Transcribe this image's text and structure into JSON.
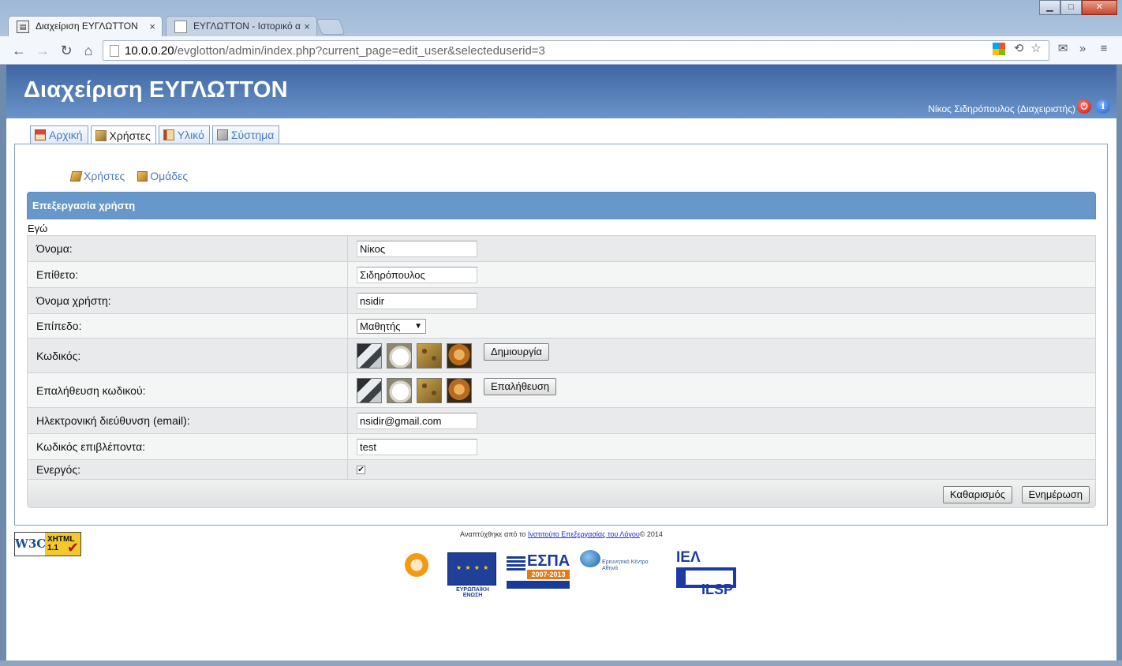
{
  "browser": {
    "tabs": [
      {
        "title": "Διαχείριση ΕΥΓΛΩΤΤΟΝ",
        "active": true
      },
      {
        "title": "ΕΥΓΛΩΤΤΟΝ - Ιστορικό α",
        "active": false
      }
    ],
    "close_glyph": "×",
    "window_controls": {
      "minimize": "▁",
      "maximize": "□",
      "close": "✕"
    },
    "url": {
      "host": "10.0.0.20",
      "path": "/evglotton/admin/index.php?current_page=edit_user&selecteduserid=3"
    },
    "icons": {
      "back": "back-arrow-icon",
      "forward": "forward-arrow-icon",
      "reload": "reload-icon",
      "home": "home-icon"
    }
  },
  "app": {
    "title": "Διαχείριση ΕΥΓΛΩΤΤΟΝ",
    "user_label": "Νίκος Σιδηρόπουλος (Διαχειριστής)",
    "info_glyph": "i",
    "power_glyph": "⏻"
  },
  "main_tabs": [
    {
      "label": "Αρχική",
      "active": false
    },
    {
      "label": "Χρήστες",
      "active": true
    },
    {
      "label": "Υλικό",
      "active": false
    },
    {
      "label": "Σύστημα",
      "active": false
    }
  ],
  "subnav": [
    {
      "label": "Χρήστες"
    },
    {
      "label": "Ομάδες"
    }
  ],
  "form": {
    "heading": "Επεξεργασία χρήστη",
    "section": "Εγώ",
    "first_name": {
      "label": "Όνομα:",
      "value": "Νίκος"
    },
    "last_name": {
      "label": "Επίθετο:",
      "value": "Σιδηρόπουλος"
    },
    "username": {
      "label": "Όνομα χρήστη:",
      "value": "nsidir"
    },
    "level": {
      "label": "Επίπεδο:",
      "selected": "Μαθητής",
      "arrow": "▼"
    },
    "password": {
      "label": "Κωδικός:",
      "button": "Δημιουργία"
    },
    "password_confirm": {
      "label": "Επαλήθευση κωδικού:",
      "button": "Επαλήθευση"
    },
    "email": {
      "label": "Ηλεκτρονική διεύθυνση (email):",
      "value": "nsidir@gmail.com"
    },
    "supervisor_code": {
      "label": "Κωδικός επιβλέποντα:",
      "value": "test"
    },
    "active": {
      "label": "Ενεργός:",
      "checked": true,
      "check_glyph": "✔"
    },
    "clear_button": "Καθαρισμός",
    "update_button": "Ενημέρωση"
  },
  "footer": {
    "credits_prefix": "Αναπτύχθηκε από το ",
    "credits_link": "Ινστιτούτο Επεξεργασίας του Λόγου",
    "credits_suffix": "© 2014",
    "w3c": {
      "w3c": "W3C",
      "xhtml": "XHTML",
      "version": "1.1",
      "check": "✔"
    },
    "logo_eu": "ΕΥΡΩΠΑΪΚΗ ΕΝΩΣΗ",
    "logo_espa": "ΕΣΠΑ",
    "logo_espa_years": "2007-2013",
    "logo_athena": "Ερευνητικό Κέντρο Αθηνά",
    "logo_ilsp_top": "ΙΕΛ",
    "logo_ilsp_bottom": "ILSP"
  }
}
